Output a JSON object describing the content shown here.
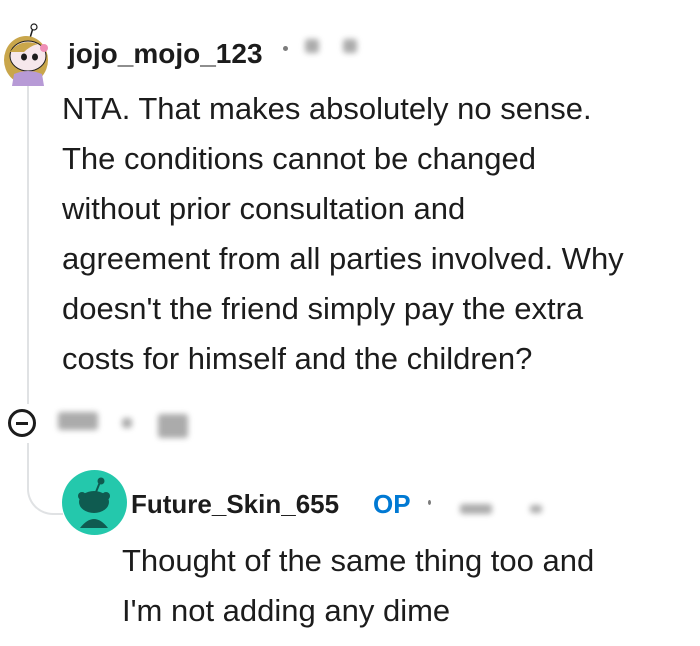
{
  "comment": {
    "author": "jojo_mojo_123",
    "body_lines": [
      "NTA. That makes absolutely no sense.",
      "The conditions cannot be changed",
      "without prior consultation and",
      "agreement from all parties involved. Why",
      "doesn't the friend simply pay the extra",
      "costs for himself and the children?"
    ],
    "avatar_icon": "snoo-avatar-icon",
    "collapse_icon": "collapse-minus-icon"
  },
  "reply": {
    "author": "Future_Skin_655",
    "op_badge": "OP",
    "body_lines": [
      "Thought of the same thing too and",
      "I'm not adding any dime"
    ],
    "avatar_icon": "snoo-avatar-icon"
  },
  "colors": {
    "op_badge": "#0079d3",
    "reply_avatar_bg": "#24c8ac",
    "thread_line": "#e0e2e4"
  }
}
